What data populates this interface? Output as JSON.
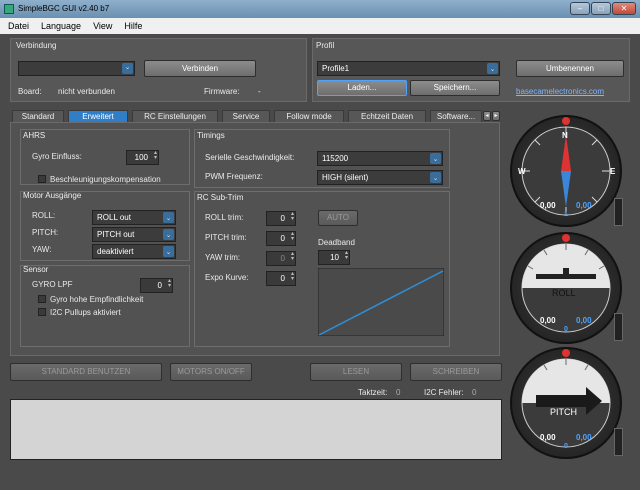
{
  "window": {
    "title": "SimpleBGC GUI v2.40 b7"
  },
  "menu": [
    "Datei",
    "Language",
    "View",
    "Hilfe"
  ],
  "connection": {
    "title": "Verbindung",
    "port_value": "",
    "connect_button": "Verbinden",
    "board_label": "Board:",
    "board_value": "nicht verbunden",
    "firmware_label": "Firmware:",
    "firmware_value": "-"
  },
  "profile": {
    "title": "Profil",
    "value": "Profile1",
    "rename_button": "Umbenennen",
    "load_button": "Laden...",
    "save_button": "Speichern...",
    "link": "basecamelectronics.com"
  },
  "tabs": [
    "Standard",
    "Erweitert",
    "RC Einstellungen",
    "Service",
    "Follow mode",
    "Echtzeit Daten",
    "Software..."
  ],
  "ahrs": {
    "title": "AHRS",
    "gyro_label": "Gyro Einfluss:",
    "gyro_value": "100",
    "accel_comp_label": "Beschleunigungskompensation"
  },
  "timings": {
    "title": "Timings",
    "serial_label": "Serielle Geschwindigkeit:",
    "serial_value": "115200",
    "pwm_label": "PWM Frequenz:",
    "pwm_value": "HIGH (silent)"
  },
  "motor": {
    "title": "Motor Ausgänge",
    "roll_label": "ROLL:",
    "roll_value": "ROLL out",
    "pitch_label": "PITCH:",
    "pitch_value": "PITCH out",
    "yaw_label": "YAW:",
    "yaw_value": "deaktiviert"
  },
  "sensor": {
    "title": "Sensor",
    "lpf_label": "GYRO LPF",
    "lpf_value": "0",
    "gyro_high_label": "Gyro hohe Empfindlichkeit",
    "i2c_label": "I2C Pullups aktiviert"
  },
  "rc_subtrim": {
    "title": "RC Sub-Trim",
    "roll_label": "ROLL trim:",
    "roll_value": "0",
    "pitch_label": "PITCH trim:",
    "pitch_value": "0",
    "yaw_label": "YAW trim:",
    "yaw_value": "0",
    "auto_button": "AUTO",
    "deadband_label": "Deadband",
    "deadband_value": "10",
    "expo_label": "Expo Kurve:",
    "expo_value": "0"
  },
  "buttons": {
    "defaults": "STANDARD BENUTZEN",
    "motors": "MOTORS ON/OFF",
    "read": "LESEN",
    "write": "SCHREIBEN"
  },
  "status": {
    "cycle_label": "Taktzeit:",
    "cycle_value": "0",
    "i2c_label": "I2C Fehler:",
    "i2c_value": "0"
  },
  "gauges": {
    "yaw": {
      "dirs": {
        "n": "N",
        "w": "W",
        "e": "E"
      },
      "v1": "0,00",
      "v2": "0,00",
      "v3": "1"
    },
    "roll": {
      "label": "ROLL",
      "v1": "0,00",
      "v2": "0,00",
      "v3": "0"
    },
    "pitch": {
      "label": "PITCH",
      "v1": "0,00",
      "v2": "0,00",
      "v3": "0"
    }
  },
  "colors": {
    "accent": "#2f7ec7",
    "blue_value": "#4ea3ff",
    "curve": "#2f8fd8"
  }
}
